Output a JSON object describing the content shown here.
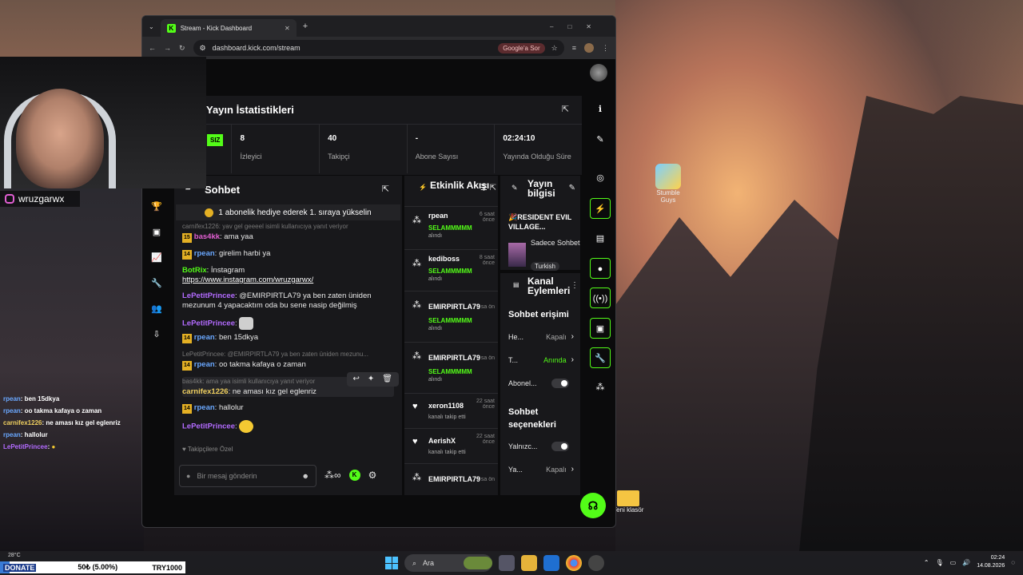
{
  "browser": {
    "tab_title": "Stream - Kick Dashboard",
    "url": "dashboard.kick.com/stream",
    "search_chip": "Google'a Sor"
  },
  "stats": {
    "title": "Yayın İstatistikleri",
    "badge": "SIZ",
    "items": [
      {
        "value": "8",
        "label": "İzleyici"
      },
      {
        "value": "40",
        "label": "Takipçi"
      },
      {
        "value": "-",
        "label": "Abone Sayısı"
      },
      {
        "value": "02:24:10",
        "label": "Yayında Olduğu Süre"
      }
    ]
  },
  "chat": {
    "title": "Sohbet",
    "pinned": "1 abonelik hediye ederek 1. sıraya yükselin",
    "messages": [
      {
        "reply": "carnifex1226: yav gel geeeel isimli kullanıcıya yanıt veriyor",
        "badge": "15",
        "user": "bas4kk",
        "text": ": ama yaa"
      },
      {
        "badge": "14",
        "user": "rpean",
        "text": ": girelim harbi ya"
      },
      {
        "user": "BotRix",
        "text": ": İnstagram",
        "link": "https://www.instagram.com/wruzgarwx/"
      },
      {
        "user": "LePetitPrincee",
        "text": ": @EMIRPIRTLA79 ya ben zaten üniden mezunum 4 yapacaktım oda bu sene nasip değilmiş"
      },
      {
        "user": "LePetitPrincee",
        "text": ":"
      },
      {
        "badge": "14",
        "user": "rpean",
        "text": ": ben 15dkya"
      },
      {
        "reply": "LePetitPrincee: @EMIRPIRTLA79 ya ben zaten üniden mezunu...",
        "badge": "14",
        "user": "rpean",
        "text": ": oo takma kafaya o zaman"
      },
      {
        "reply": "bas4kk: ama yaa isimli kullanıcıya yanıt veriyor",
        "user": "carnifex1226",
        "text": ": ne aması kız gel eglenriz"
      },
      {
        "badge": "14",
        "user": "rpean",
        "text": ": hallolur"
      },
      {
        "user": "LePetitPrincee",
        "text": ":"
      }
    ],
    "followers_only": "Takipçilere Özel",
    "input_placeholder": "Bir mesaj gönderin"
  },
  "activity": {
    "title": "Etkinlik Akışı",
    "events": [
      {
        "user": "rpean",
        "time": "6 saat önce",
        "msg": "SELAMMMMM",
        "sub": "alındı"
      },
      {
        "user": "kediboss",
        "time": "8 saat önce",
        "msg": "SELAMMMMM",
        "sub": "alındı"
      },
      {
        "user": "EMIRPIRTLA79",
        "time": "sa ön",
        "msg": "SELAMMMMM",
        "sub": "alındı"
      },
      {
        "user": "EMIRPIRTLA79",
        "time": "sa ön",
        "msg": "SELAMMMMM",
        "sub": "alındı"
      },
      {
        "user": "xeron1108",
        "time": "22 saat önce",
        "sub": "kanalı takip etti"
      },
      {
        "user": "AerishX",
        "time": "22 saat önce",
        "sub": "kanalı takip etti"
      },
      {
        "user": "EMIRPIRTLA79",
        "time": "sa ön"
      }
    ]
  },
  "stream_info": {
    "title": "Yayın bilgisi",
    "stream_title": "🎉RESIDENT EVIL VILLAGE...",
    "category": "Sadece Sohbet",
    "tag": "Turkish"
  },
  "channel_actions": {
    "title": "Kanal Eylemleri",
    "chat_access": "Sohbet erişimi",
    "opt1_label": "He...",
    "opt1_value": "Kapalı",
    "opt2_label": "T...",
    "opt2_value": "Anında",
    "opt3_label": "Abonel...",
    "chat_options": "Sohbet seçenekleri",
    "opt4_label": "Yalnızc...",
    "opt5_label": "Ya...",
    "opt5_value": "Kapalı"
  },
  "overlay": {
    "instagram_handle": "wruzgarwx",
    "chat": [
      {
        "user": "rpean",
        "text": ": ben 15dkya"
      },
      {
        "user": "rpean",
        "text": ": oo takma kafaya o zaman"
      },
      {
        "user": "carnifex1226",
        "text": ": ne aması kız gel eglenriz"
      },
      {
        "user": "rpean",
        "text": ": hallolur"
      },
      {
        "user": "LePetitPrincee",
        "text": ":"
      }
    ],
    "donate_label": "DONATE",
    "donate_amount": "50₺ (5.00%)",
    "donate_goal": "TRY1000",
    "donate_progress": 0.05
  },
  "desktop": {
    "stumble_label": "Stumble Guys",
    "folder_label": "Yeni klasör",
    "weather": "28°C"
  },
  "taskbar": {
    "search": "Ara",
    "time": "02:24",
    "date": "14.08.2026"
  },
  "colors": {
    "kick_green": "#53fc18",
    "panel": "#18181b",
    "background": "#0b0b0c"
  }
}
